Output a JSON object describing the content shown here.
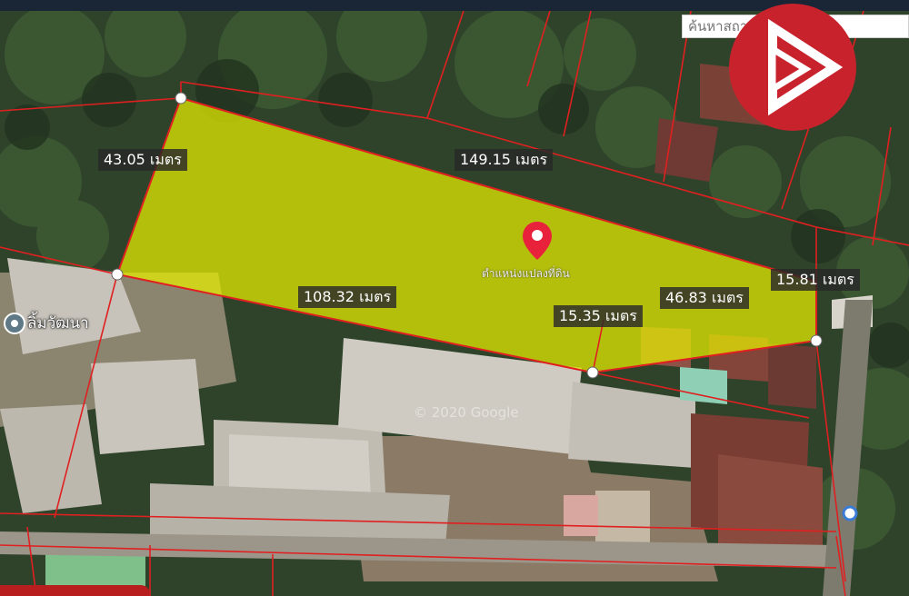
{
  "map": {
    "search_placeholder": "ค้นหาสถานที่สำคัญ",
    "place_name": "ลิ้มวัฒนา",
    "parcel_caption": "ตำแหน่งแปลงที่ดิน",
    "watermark": "© 2020 Google",
    "measurements": [
      "43.05 เมตร",
      "149.15 เมตร",
      "108.32 เมตร",
      "15.35 เมตร",
      "46.83 เมตร",
      "15.81 เมตร"
    ],
    "colors": {
      "parcel_fill": "#e8f000",
      "boundary_line": "#e02020",
      "logo_red": "#c8232c",
      "pin_red": "#e8223b"
    },
    "icons": [
      "brand-logo-icon",
      "location-pin-icon",
      "place-marker-icon"
    ]
  }
}
